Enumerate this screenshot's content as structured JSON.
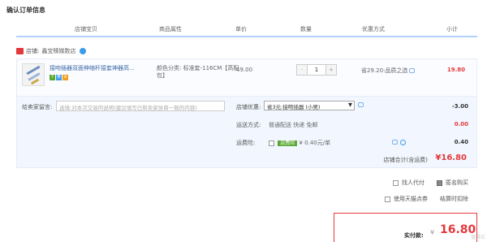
{
  "title": "确认订单信息",
  "columns": [
    "店铺宝贝",
    "商品属性",
    "单价",
    "数量",
    "优惠方式",
    "小计"
  ],
  "shop": {
    "label": "店铺:",
    "name": "鑫宝臻媒数店"
  },
  "item": {
    "name": "接吻插器双面伸缩杆接套神器高...",
    "property": "颜色分类: 标准套-116CM【高配包】",
    "price": "49.00",
    "qty_minus": "-",
    "qty": "1",
    "qty_plus": "+",
    "discount": "省29.20:品质之选",
    "subtotal": "19.80",
    "badges": [
      "7",
      "券",
      "≡"
    ]
  },
  "message": {
    "label": "给卖家留言:",
    "placeholder": "选填:对本次交易的说明(建议填写已和卖家协商一致的内容)"
  },
  "store_discount": {
    "label": "店铺优惠:",
    "option": "省3元:接吻插器 (小吴)",
    "arrow": "▼",
    "amount": "-3.00"
  },
  "shipping": {
    "label": "运送方式:",
    "option": "普通配送 快递 免邮",
    "amount": "0.00"
  },
  "insurance": {
    "label": "运费险:",
    "tag": "运费险",
    "detail": "¥ 0.40元/单",
    "amount": "0.40"
  },
  "store_total": {
    "label": "店铺合计(含运费)",
    "amount": "¥16.80"
  },
  "options": {
    "proxy_pay": "找人代付",
    "anonymous": "匿名购买",
    "tmall_coupon": "使用天猫点券",
    "settle": "结算时扣除"
  },
  "summary": {
    "label": "实付款:",
    "currency": "¥",
    "amount": "16.80"
  },
  "watermark": "值得买"
}
